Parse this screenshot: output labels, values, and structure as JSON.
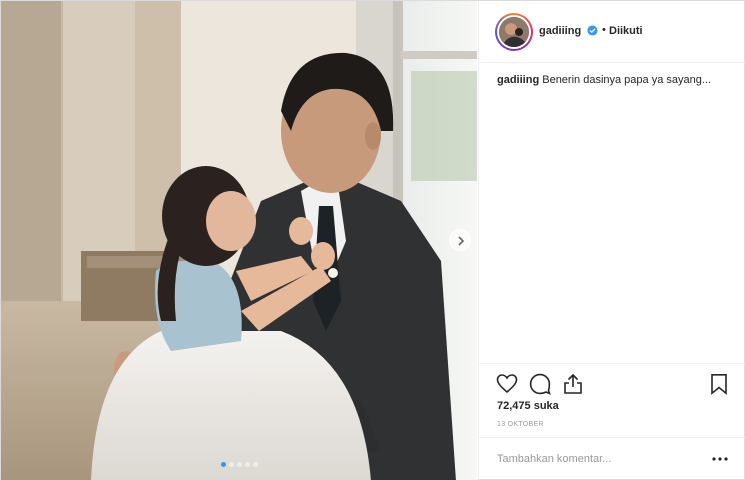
{
  "post": {
    "username": "gadiiing",
    "verified": true,
    "separator": "•",
    "follow_status": "Diikuti",
    "caption": {
      "username": "gadiiing",
      "text": "Benerin dasinya papa ya sayang..."
    },
    "likes_text": "72,475 suka",
    "date_text": "13 OKTOBER",
    "comment_placeholder": "Tambahkan komentar..."
  },
  "carousel": {
    "slide_count": 5,
    "active_index": 0
  },
  "icons": {
    "like": "heart-icon",
    "comment": "comment-bubble-icon",
    "share": "share-icon",
    "save": "bookmark-icon",
    "more": "more-options-icon",
    "next": "chevron-right-icon",
    "verified": "verified-badge-icon"
  },
  "colors": {
    "accent": "#3897f0",
    "text": "#262626",
    "muted": "#999999",
    "border": "#efefef"
  }
}
